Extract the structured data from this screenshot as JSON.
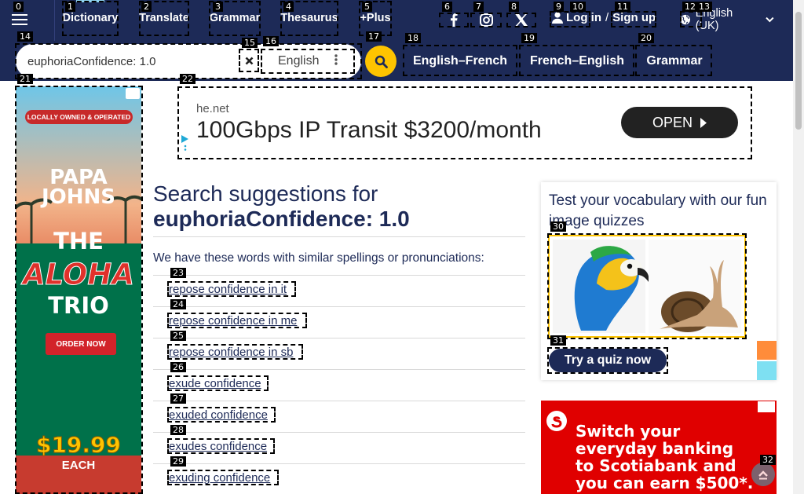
{
  "nav": {
    "links": [
      "Dictionary",
      "Translate",
      "Grammar",
      "Thesaurus",
      "+Plus"
    ],
    "login": "Log in",
    "auth_separator": "/",
    "signup": "Sign up",
    "language": "English (UK)"
  },
  "search": {
    "value": "euphoriaConfidence: 1.0",
    "dictionary_language": "English"
  },
  "dictionary_tabs": [
    "English–French",
    "French–English",
    "Grammar"
  ],
  "ads": {
    "top": {
      "domain": "he.net",
      "headline": "100Gbps IP Transit $3200/month",
      "cta": "OPEN"
    },
    "left": {
      "badge": "LOCALLY OWNED & OPERATED",
      "brand_line1": "PAPA",
      "brand_line2": "JOHNS",
      "the": "THE",
      "promo": "ALOHA",
      "trio": "TRIO",
      "cta": "ORDER NOW",
      "price": "$19.99",
      "price_unit": "EACH"
    },
    "right": {
      "line1": "Switch your",
      "line2": "everyday banking",
      "line3": "to Scotiabank and",
      "line4": "you can earn $500*."
    }
  },
  "main": {
    "heading_prefix": "Search suggestions for",
    "heading_term": "euphoriaConfidence: 1.0",
    "intro": "We have these words with similar spellings or pronunciations:",
    "suggestions": [
      "repose confidence in it",
      "repose confidence in me",
      "repose confidence in sb",
      "exude confidence",
      "exuded confidence",
      "exudes confidence",
      "exuding confidence"
    ]
  },
  "quiz": {
    "title": "Test your vocabulary with our fun image quizzes",
    "button": "Try a quiz now"
  },
  "labels": [
    "0",
    "1",
    "2",
    "3",
    "4",
    "5",
    "6",
    "7",
    "8",
    "9",
    "10",
    "11",
    "12",
    "13",
    "14",
    "15",
    "16",
    "17",
    "18",
    "19",
    "20",
    "21",
    "22",
    "23",
    "24",
    "25",
    "26",
    "27",
    "28",
    "29",
    "30",
    "31",
    "32"
  ],
  "colors": {
    "brand_navy": "#1d2a57",
    "accent_yellow": "#fec400",
    "accent_cyan": "#8fd3f0"
  },
  "icons": [
    "menu-icon",
    "facebook-icon",
    "instagram-icon",
    "x-icon",
    "user-icon",
    "globe-icon",
    "chevron-down-icon",
    "close-icon",
    "more-vertical-icon",
    "search-icon",
    "arrow-up-icon"
  ]
}
